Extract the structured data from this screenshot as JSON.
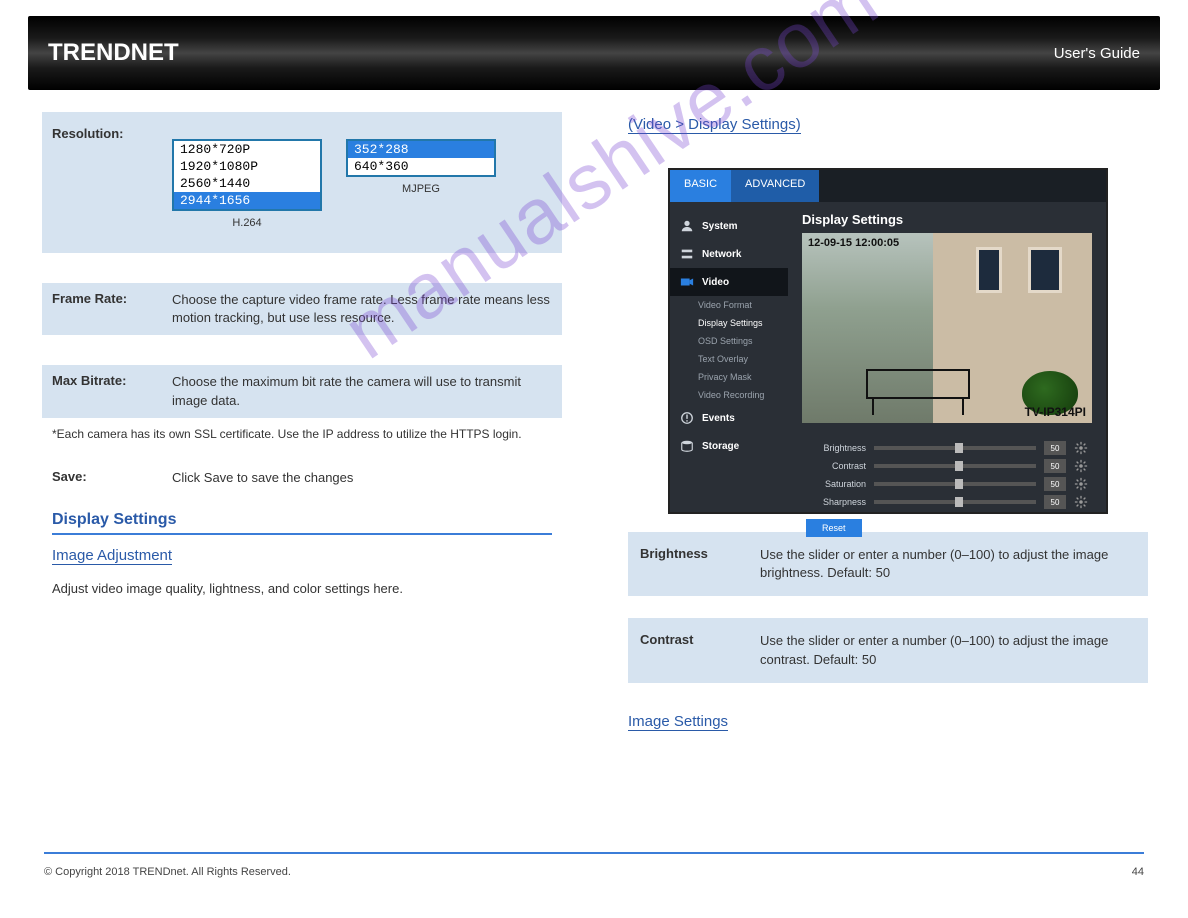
{
  "header": {
    "brand": "TRENDNET",
    "subtitle": "User's Guide"
  },
  "watermark": "manualshive.com",
  "left": {
    "resolution": {
      "label": "Resolution:",
      "h264_options": [
        "1280*720P",
        "1920*1080P",
        "2560*1440",
        "2944*1656"
      ],
      "h264_selected_index": 3,
      "mjpeg_options": [
        "352*288",
        "640*360"
      ],
      "mjpeg_selected_index": 0,
      "sub_labels": {
        "h264": "H.264",
        "mjpeg": "MJPEG"
      }
    },
    "framerate": {
      "key": "Frame Rate:",
      "val": "Choose the capture video frame rate. Less frame rate means less motion tracking, but use less resource."
    },
    "bitrate": {
      "key": "Max Bitrate:",
      "val": "Choose the maximum bit rate the camera will use to transmit image data."
    },
    "note_star": "*Each camera has its own SSL certificate. Use the IP address to utilize the HTTPS login.",
    "save": {
      "key": "Save:",
      "val": "Click Save to save the changes"
    },
    "display_hdr": "Display Settings",
    "image_adj_link": "Image Adjustment",
    "image_adj_body": "Adjust video image quality, lightness, and color settings here."
  },
  "right": {
    "link": "(Video > Display Settings)",
    "device": {
      "tabs": {
        "basic": "BASIC",
        "advanced": "ADVANCED"
      },
      "title": "Display Settings",
      "timestamp": "12-09-15 12:00:05",
      "model": "TV-IP314PI",
      "side_main": [
        "System",
        "Network",
        "Video",
        "Events",
        "Storage"
      ],
      "side_sub": [
        "Video Format",
        "Display Settings",
        "OSD Settings",
        "Text Overlay",
        "Privacy Mask",
        "Video Recording"
      ],
      "sliders": [
        {
          "label": "Brightness",
          "val": "50"
        },
        {
          "label": "Contrast",
          "val": "50"
        },
        {
          "label": "Saturation",
          "val": "50"
        },
        {
          "label": "Sharpness",
          "val": "50"
        }
      ],
      "reset": "Reset"
    },
    "brightness": {
      "key": "Brightness",
      "val": "Use the slider or enter a number (0–100) to adjust the image brightness. Default: 50"
    },
    "contrast": {
      "key": "Contrast",
      "val": "Use the slider or enter a number (0–100) to adjust the image contrast. Default: 50"
    },
    "image_sett_link": "Image Settings"
  },
  "footer": {
    "copyright": "© Copyright 2018 TRENDnet. All Rights Reserved.",
    "page": "44"
  }
}
